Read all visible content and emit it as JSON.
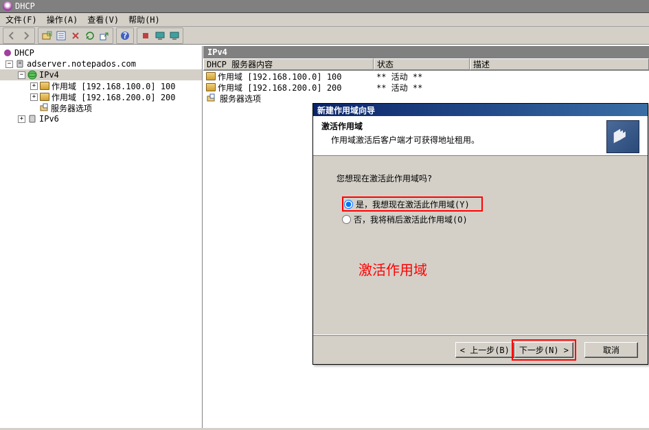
{
  "app": {
    "title": "DHCP"
  },
  "menu": {
    "file": "文件(F)",
    "action": "操作(A)",
    "view": "查看(V)",
    "help": "帮助(H)"
  },
  "tree": {
    "root": "DHCP",
    "server": "adserver.notepados.com",
    "ipv4": "IPv4",
    "scope1": "作用域 [192.168.100.0] 100",
    "scope2": "作用域 [192.168.200.0] 200",
    "server_options": "服务器选项",
    "ipv6": "IPv6"
  },
  "right": {
    "header": "IPv4",
    "columns": {
      "c1": "DHCP 服务器内容",
      "c2": "状态",
      "c3": "描述"
    },
    "rows": [
      {
        "name": "作用域 [192.168.100.0] 100",
        "status": "** 活动 **",
        "desc": ""
      },
      {
        "name": "作用域 [192.168.200.0] 200",
        "status": "** 活动 **",
        "desc": ""
      },
      {
        "name": "服务器选项",
        "status": "",
        "desc": ""
      }
    ]
  },
  "wizard": {
    "title": "新建作用域向导",
    "head_title": "激活作用域",
    "head_sub": "作用域激活后客户端才可获得地址租用。",
    "prompt": "您想现在激活此作用域吗?",
    "opt_yes": "是，我想现在激活此作用域(Y)",
    "opt_no": "否，我将稍后激活此作用域(O)",
    "annotation": "激活作用域",
    "back": "< 上一步(B)",
    "next": "下一步(N) >",
    "cancel": "取消"
  }
}
